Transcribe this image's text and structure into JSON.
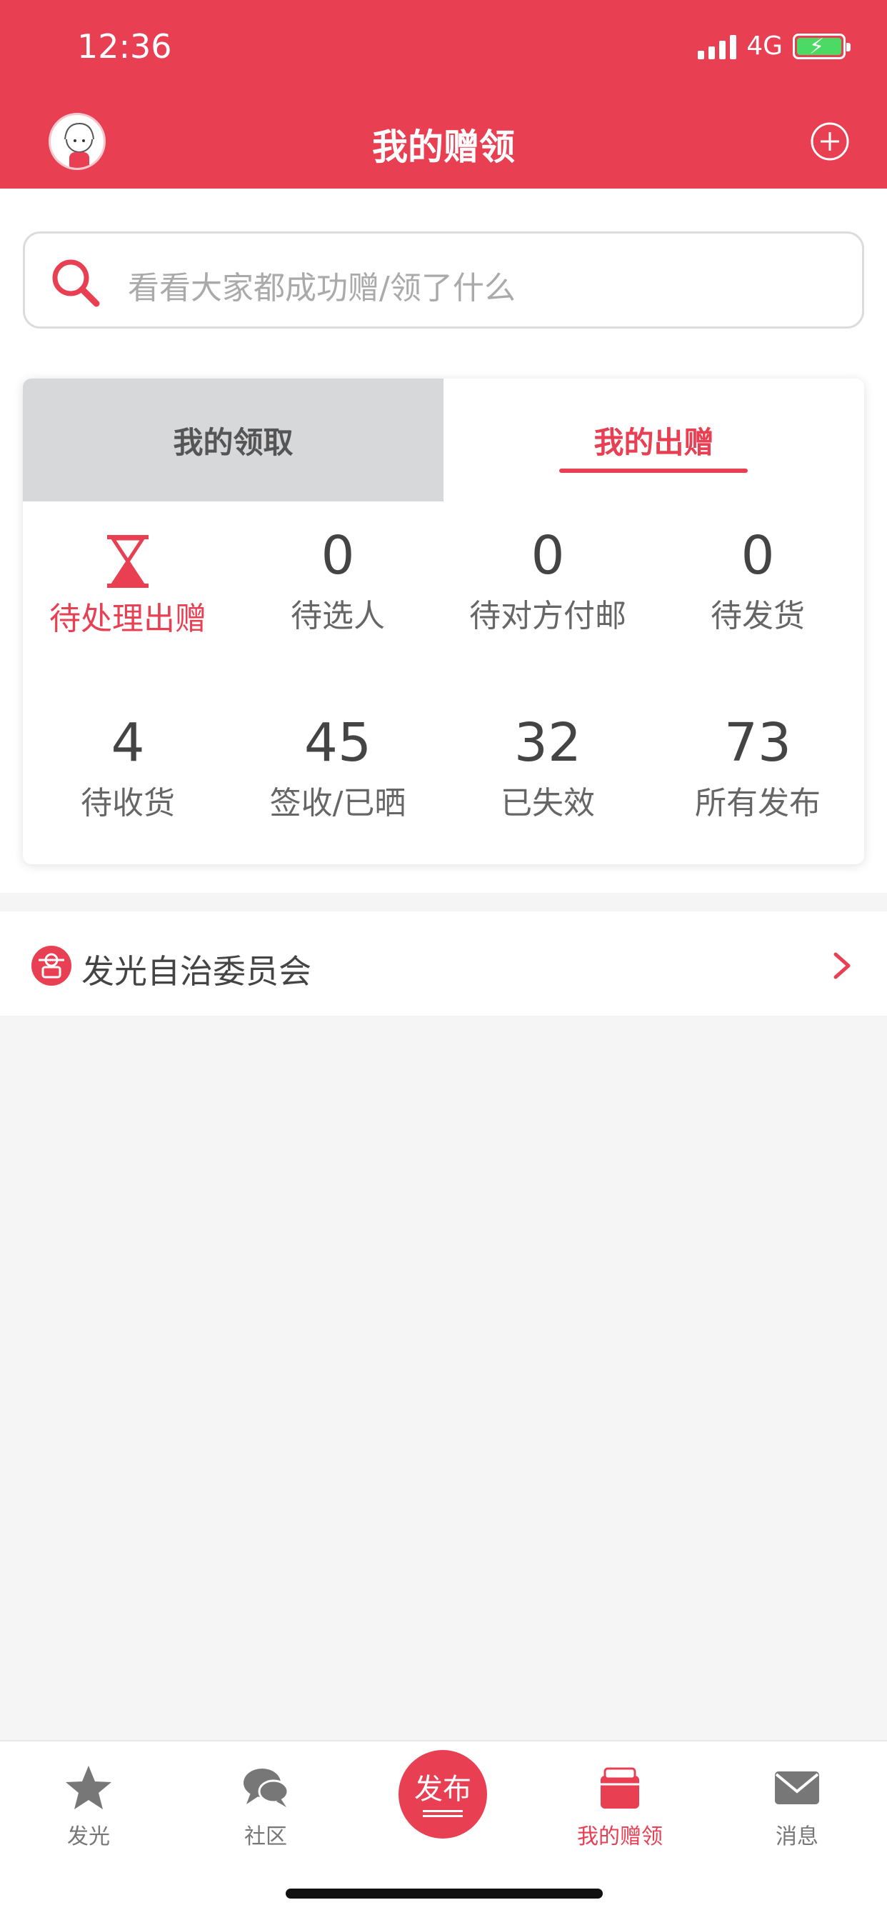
{
  "status": {
    "time": "12:36",
    "network": "4G"
  },
  "header": {
    "title": "我的赠领"
  },
  "search": {
    "placeholder": "看看大家都成功赠/领了什么"
  },
  "tabs": [
    {
      "label": "我的领取",
      "active": false
    },
    {
      "label": "我的出赠",
      "active": true
    }
  ],
  "stats_row1": [
    {
      "label": "待处理出赠",
      "icon": "hourglass-icon",
      "active": true
    },
    {
      "value": "0",
      "label": "待选人"
    },
    {
      "value": "0",
      "label": "待对方付邮"
    },
    {
      "value": "0",
      "label": "待发货"
    }
  ],
  "stats_row2": [
    {
      "value": "4",
      "label": "待收货"
    },
    {
      "value": "45",
      "label": "签收/已晒"
    },
    {
      "value": "32",
      "label": "已失效"
    },
    {
      "value": "73",
      "label": "所有发布"
    }
  ],
  "committee": {
    "label": "发光自治委员会"
  },
  "tabbar": [
    {
      "label": "发光",
      "icon": "star-icon"
    },
    {
      "label": "社区",
      "icon": "chat-bubbles-icon"
    },
    {
      "label": "发布",
      "icon": "publish-button"
    },
    {
      "label": "我的赠领",
      "icon": "gift-box-icon",
      "active": true
    },
    {
      "label": "消息",
      "icon": "envelope-icon"
    }
  ],
  "colors": {
    "brand": "#e83f53",
    "background": "#f5f5f5",
    "tab_inactive": "#d7d8da"
  }
}
